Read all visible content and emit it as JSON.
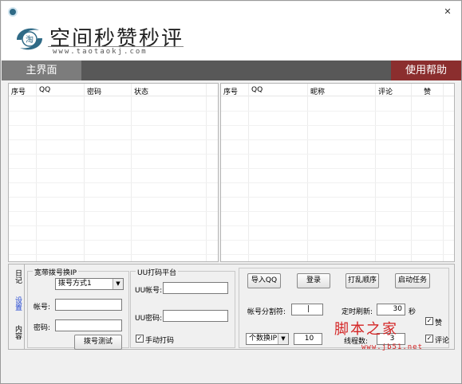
{
  "window": {
    "close_glyph": "✕"
  },
  "logo": {
    "title": "空间秒赞秒评",
    "url": "www.taotaokj.com",
    "emblem_char": "淘"
  },
  "nav": {
    "main_tab": "主界面",
    "help_tab": "使用帮助"
  },
  "left_table": {
    "columns": [
      "序号",
      "QQ",
      "密码",
      "状态"
    ]
  },
  "right_table": {
    "columns": [
      "序号",
      "QQ",
      "昵称",
      "评论",
      "赞"
    ]
  },
  "side_tabs": [
    "日记",
    "设置",
    "内容"
  ],
  "broadband": {
    "legend": "宽带拨号换IP",
    "dial_mode": "拨号方式1",
    "account_label": "帐号:",
    "password_label": "密码:",
    "test_button": "拨号测试"
  },
  "captcha": {
    "legend": "UU打码平台",
    "account_label": "UU帐号:",
    "password_label": "UU密码:",
    "manual_label": "手动打码",
    "manual_checked": true
  },
  "tasks": {
    "import_button": "导入QQ",
    "login_button": "登录",
    "shuffle_button": "打乱顺序",
    "start_button": "启动任务",
    "separator_label": "帐号分割符:",
    "separator_value": "|",
    "refresh_label": "定时刷新:",
    "refresh_value": "30",
    "refresh_unit": "秒",
    "like_label": "赞",
    "like_checked": true,
    "switch_mode": "个数换IP",
    "switch_value": "10",
    "threads_label": "线程数:",
    "threads_value": "3",
    "comment_label": "评论",
    "comment_checked": true
  },
  "watermark": {
    "text": "脚本之家",
    "url": "www.jb51.net"
  }
}
